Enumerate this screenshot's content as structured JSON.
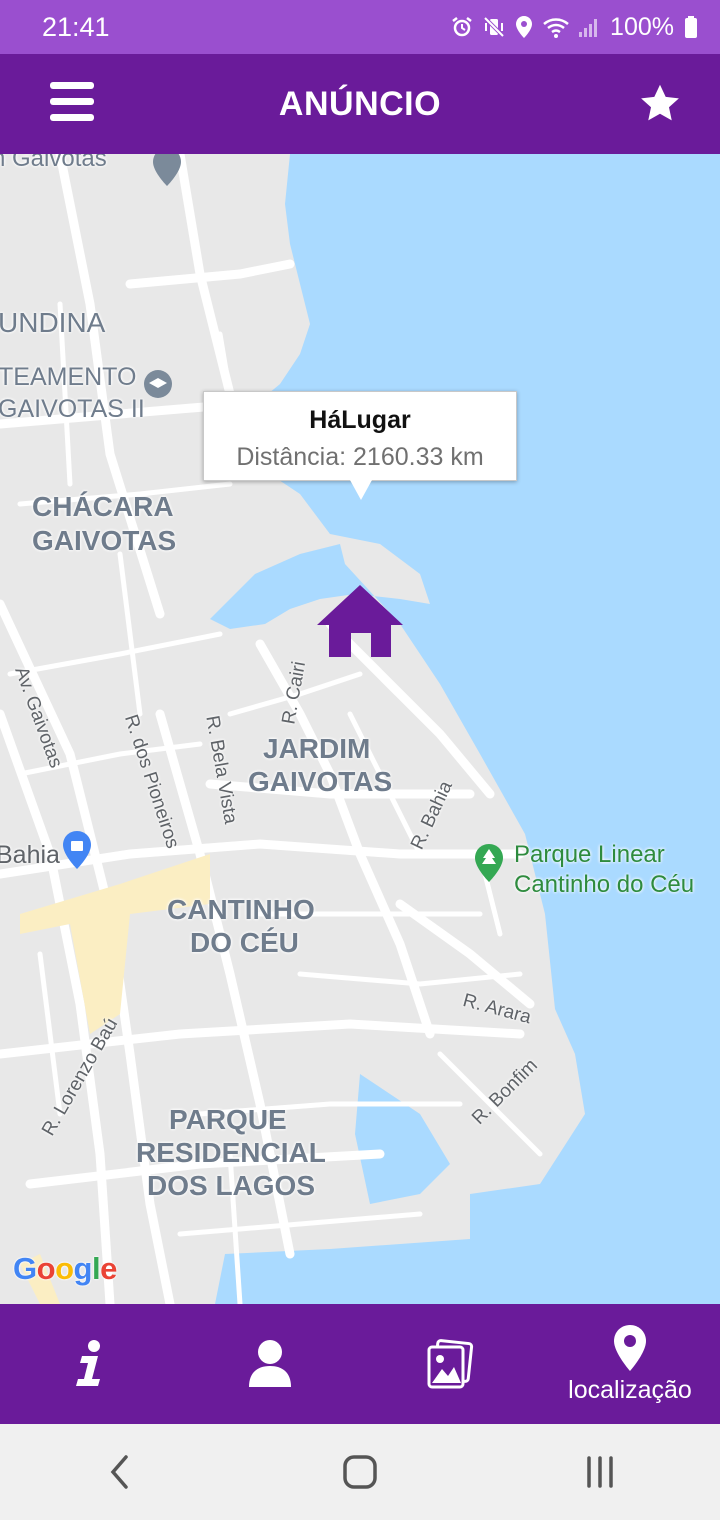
{
  "status_bar": {
    "time": "21:41",
    "battery": "100%"
  },
  "app_bar": {
    "title": "ANÚNCIO"
  },
  "map": {
    "areas": [
      "im Gaivotas",
      "UNDINA",
      "TEAMENTO",
      "GAIVOTAS II",
      "CHÁCARA",
      "GAIVOTAS",
      "JARDIM",
      "GAIVOTAS",
      "CANTINHO",
      "DO CÉU",
      "PARQUE",
      "RESIDENCIAL",
      "DOS LAGOS"
    ],
    "streets": [
      "Av. Gaivotas",
      "R. dos Pioneiros",
      "R. Bela Vista",
      "R. Cairi",
      "R. Bahia",
      "R. Arara",
      "R. Bonfim",
      "R. Lorenzo Baú"
    ],
    "poi": {
      "bahia": "Bahia"
    },
    "park": {
      "line1": "Parque Linear",
      "line2": "Cantinho do Céu"
    },
    "info_window": {
      "title": "HáLugar",
      "distance": "Distância: 2160.33 km"
    },
    "google_logo": [
      "G",
      "o",
      "o",
      "g",
      "l",
      "e"
    ],
    "colors": {
      "water": "#aadaff",
      "land": "#e8e8e8",
      "road": "#ffffff",
      "highlight_road": "#fbeec3",
      "marker": "#6a1b9a"
    }
  },
  "bottom_nav": {
    "items": [
      {
        "icon": "info-icon",
        "label": ""
      },
      {
        "icon": "person-icon",
        "label": ""
      },
      {
        "icon": "photos-icon",
        "label": ""
      },
      {
        "icon": "location-pin-icon",
        "label": "localização"
      }
    ]
  },
  "colors": {
    "primary": "#6a1b9a",
    "status_bar": "#9a4fcf"
  }
}
